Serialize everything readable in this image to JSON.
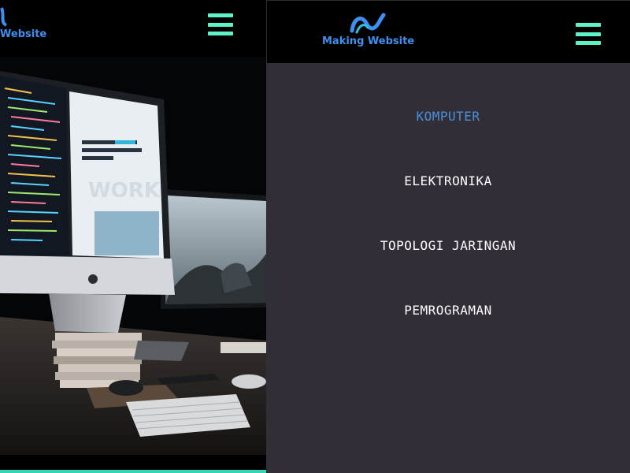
{
  "brand": {
    "name": "Making Website",
    "left_visible_text": "Website",
    "color": "#3f8ff0"
  },
  "header": {
    "menu_icon": "hamburger-icon",
    "menu_icon_color": "#5ef2c8"
  },
  "hero": {
    "image": "desk-with-computer-monitors-photo",
    "screen_text": "WORK"
  },
  "menu": {
    "items": [
      {
        "label": "KOMPUTER",
        "active": true
      },
      {
        "label": "ELEKTRONIKA",
        "active": false
      },
      {
        "label": "TOPOLOGI JARINGAN",
        "active": false
      },
      {
        "label": "PEMROGRAMAN",
        "active": false
      }
    ],
    "background": "#322e37",
    "active_color": "#4a90d9",
    "text_color": "#ffffff"
  }
}
